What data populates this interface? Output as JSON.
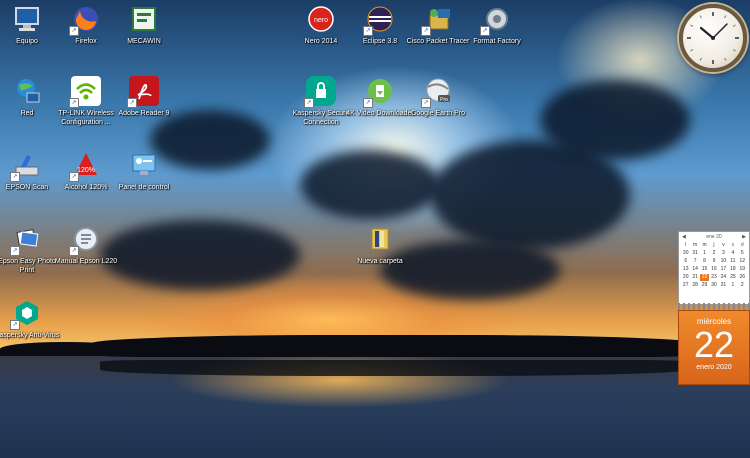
{
  "desktop": {
    "icons": [
      {
        "label": "Equipo",
        "icon": "computer-icon"
      },
      {
        "label": "Firefox",
        "icon": "firefox-icon"
      },
      {
        "label": "MECAWIN",
        "icon": "mecawin-icon"
      },
      {
        "label": "Nero 2014",
        "icon": "nero-icon"
      },
      {
        "label": "Eclipse 3.8",
        "icon": "eclipse-icon"
      },
      {
        "label": "Cisco Packet Tracer",
        "icon": "cisco-packet-tracer-icon"
      },
      {
        "label": "Format Factory",
        "icon": "format-factory-icon"
      },
      {
        "label": "Red",
        "icon": "network-icon"
      },
      {
        "label": "TP-LINK Wireless Configuration ...",
        "icon": "tplink-wireless-icon"
      },
      {
        "label": "Adobe Reader 9",
        "icon": "adobe-reader-icon"
      },
      {
        "label": "Kaspersky Secure Connection",
        "icon": "kaspersky-secure-connection-icon"
      },
      {
        "label": "4K Video Downloader",
        "icon": "4k-video-downloader-icon"
      },
      {
        "label": "Google Earth Pro",
        "icon": "google-earth-pro-icon"
      },
      {
        "label": "EPSON Scan",
        "icon": "epson-scan-icon"
      },
      {
        "label": "Alcohol 120%",
        "icon": "alcohol-120-icon"
      },
      {
        "label": "Panel de control",
        "icon": "control-panel-icon"
      },
      {
        "label": "Epson Easy Photo Print",
        "icon": "epson-easy-photo-print-icon"
      },
      {
        "label": "Manual Epson L220",
        "icon": "manual-epson-icon"
      },
      {
        "label": "Nueva carpeta",
        "icon": "folder-icon"
      },
      {
        "label": "Kaspersky Anti-Virus",
        "icon": "kaspersky-antivirus-icon"
      }
    ]
  },
  "gadgets": {
    "clock": {
      "time": "10:10"
    },
    "calendar": {
      "month_year": "ene 20",
      "weekday_headers": [
        "l",
        "m",
        "m",
        "j",
        "v",
        "s",
        "d"
      ],
      "days": [
        "30",
        "31",
        "1",
        "2",
        "3",
        "4",
        "5",
        "6",
        "7",
        "8",
        "9",
        "10",
        "11",
        "12",
        "13",
        "14",
        "15",
        "16",
        "17",
        "18",
        "19",
        "20",
        "21",
        "22",
        "23",
        "24",
        "25",
        "26",
        "27",
        "28",
        "29",
        "30",
        "31",
        "1",
        "2"
      ],
      "today": "22",
      "day_name": "miércoles",
      "day_number": "22",
      "month_full": "enero 2020"
    }
  }
}
